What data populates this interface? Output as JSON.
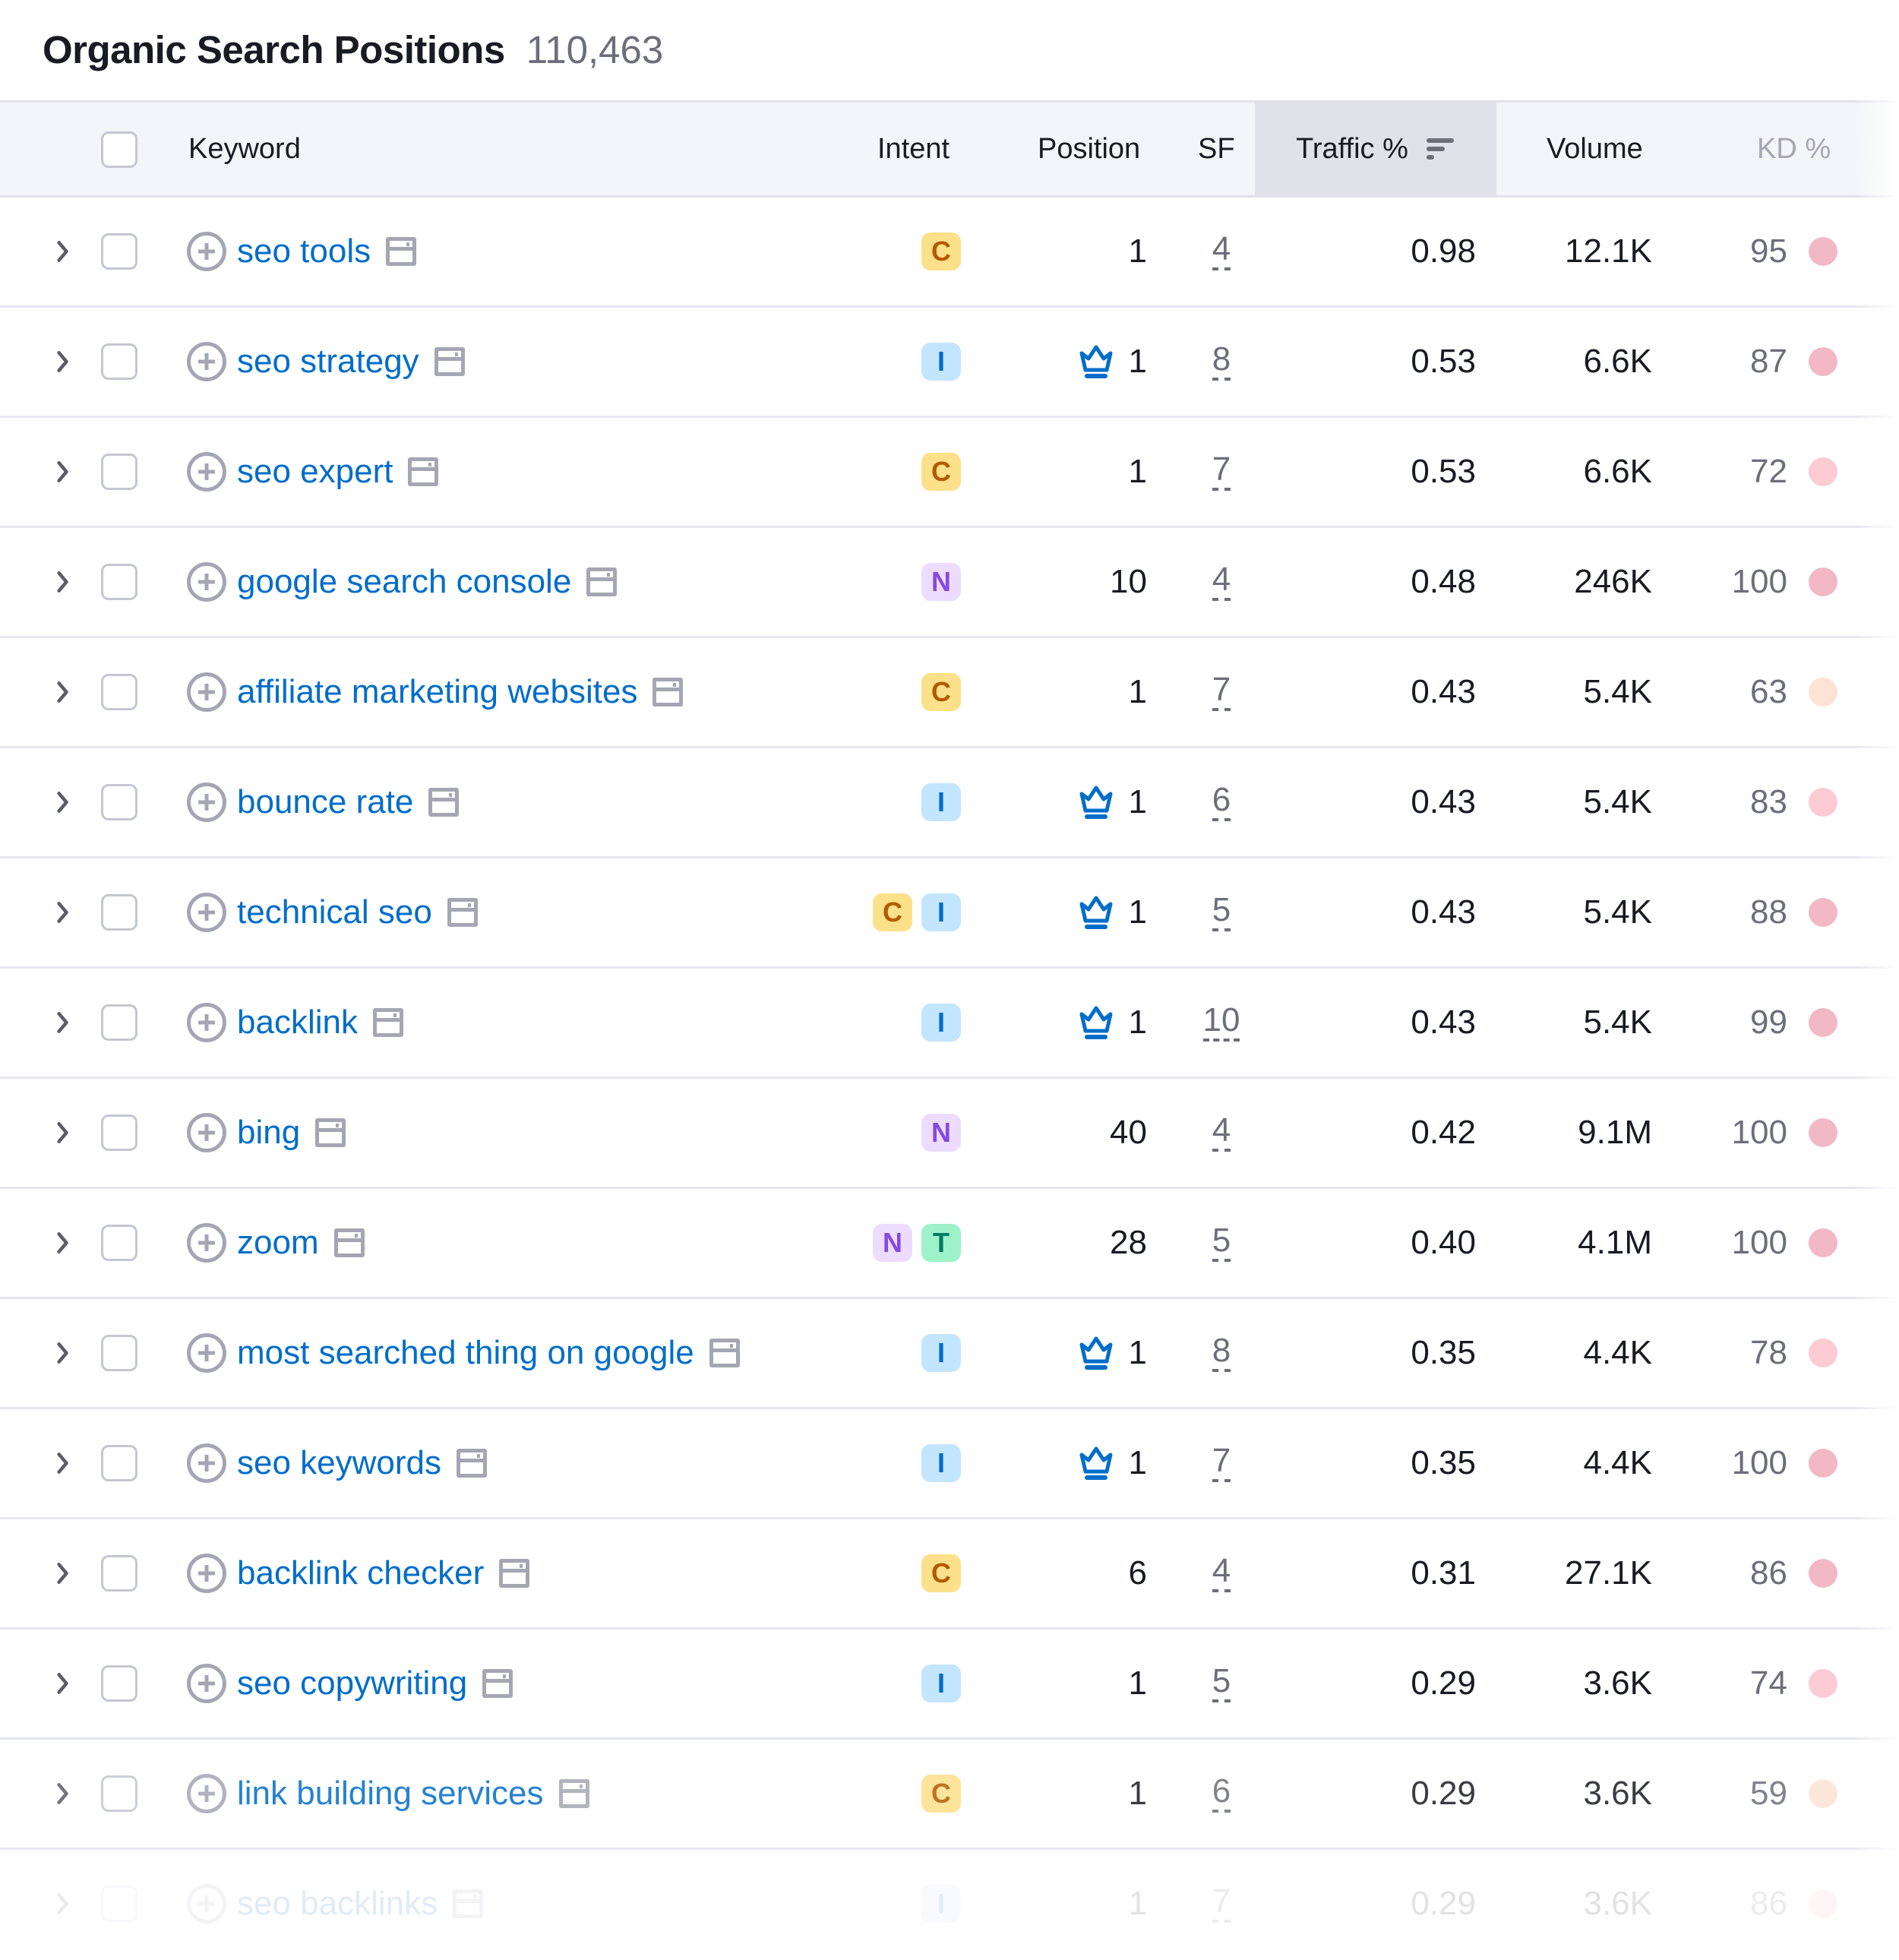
{
  "header": {
    "title": "Organic Search Positions",
    "count": "110,463"
  },
  "columns": {
    "keyword": "Keyword",
    "intent": "Intent",
    "position": "Position",
    "sf": "SF",
    "traffic": "Traffic %",
    "volume": "Volume",
    "kd": "KD %"
  },
  "intent_colors": {
    "C": {
      "bg": "#fde08a",
      "fg": "#b35a00"
    },
    "I": {
      "bg": "#c4e5fe",
      "fg": "#006dca"
    },
    "N": {
      "bg": "#eddcff",
      "fg": "#8649e1"
    },
    "T": {
      "bg": "#9ef2c9",
      "fg": "#007c65"
    }
  },
  "kd_colors": {
    "very_hard": "#f2b8c6",
    "hard": "#fccbd3",
    "difficult": "#fde3d5"
  },
  "rows": [
    {
      "keyword": "seo tools",
      "intent": [
        "C"
      ],
      "crown": false,
      "position": "1",
      "sf": "4",
      "traffic": "0.98",
      "volume": "12.1K",
      "kd": "95",
      "kd_level": "very_hard"
    },
    {
      "keyword": "seo strategy",
      "intent": [
        "I"
      ],
      "crown": true,
      "position": "1",
      "sf": "8",
      "traffic": "0.53",
      "volume": "6.6K",
      "kd": "87",
      "kd_level": "very_hard"
    },
    {
      "keyword": "seo expert",
      "intent": [
        "C"
      ],
      "crown": false,
      "position": "1",
      "sf": "7",
      "traffic": "0.53",
      "volume": "6.6K",
      "kd": "72",
      "kd_level": "hard"
    },
    {
      "keyword": "google search console",
      "intent": [
        "N"
      ],
      "crown": false,
      "position": "10",
      "sf": "4",
      "traffic": "0.48",
      "volume": "246K",
      "kd": "100",
      "kd_level": "very_hard"
    },
    {
      "keyword": "affiliate marketing websites",
      "intent": [
        "C"
      ],
      "crown": false,
      "position": "1",
      "sf": "7",
      "traffic": "0.43",
      "volume": "5.4K",
      "kd": "63",
      "kd_level": "difficult"
    },
    {
      "keyword": "bounce rate",
      "intent": [
        "I"
      ],
      "crown": true,
      "position": "1",
      "sf": "6",
      "traffic": "0.43",
      "volume": "5.4K",
      "kd": "83",
      "kd_level": "hard"
    },
    {
      "keyword": "technical seo",
      "intent": [
        "C",
        "I"
      ],
      "crown": true,
      "position": "1",
      "sf": "5",
      "traffic": "0.43",
      "volume": "5.4K",
      "kd": "88",
      "kd_level": "very_hard"
    },
    {
      "keyword": "backlink",
      "intent": [
        "I"
      ],
      "crown": true,
      "position": "1",
      "sf": "10",
      "traffic": "0.43",
      "volume": "5.4K",
      "kd": "99",
      "kd_level": "very_hard"
    },
    {
      "keyword": "bing",
      "intent": [
        "N"
      ],
      "crown": false,
      "position": "40",
      "sf": "4",
      "traffic": "0.42",
      "volume": "9.1M",
      "kd": "100",
      "kd_level": "very_hard"
    },
    {
      "keyword": "zoom",
      "intent": [
        "N",
        "T"
      ],
      "crown": false,
      "position": "28",
      "sf": "5",
      "traffic": "0.40",
      "volume": "4.1M",
      "kd": "100",
      "kd_level": "very_hard"
    },
    {
      "keyword": "most searched thing on google",
      "intent": [
        "I"
      ],
      "crown": true,
      "position": "1",
      "sf": "8",
      "traffic": "0.35",
      "volume": "4.4K",
      "kd": "78",
      "kd_level": "hard"
    },
    {
      "keyword": "seo keywords",
      "intent": [
        "I"
      ],
      "crown": true,
      "position": "1",
      "sf": "7",
      "traffic": "0.35",
      "volume": "4.4K",
      "kd": "100",
      "kd_level": "very_hard"
    },
    {
      "keyword": "backlink checker",
      "intent": [
        "C"
      ],
      "crown": false,
      "position": "6",
      "sf": "4",
      "traffic": "0.31",
      "volume": "27.1K",
      "kd": "86",
      "kd_level": "very_hard"
    },
    {
      "keyword": "seo copywriting",
      "intent": [
        "I"
      ],
      "crown": false,
      "position": "1",
      "sf": "5",
      "traffic": "0.29",
      "volume": "3.6K",
      "kd": "74",
      "kd_level": "hard"
    },
    {
      "keyword": "link building services",
      "intent": [
        "C"
      ],
      "crown": false,
      "position": "1",
      "sf": "6",
      "traffic": "0.29",
      "volume": "3.6K",
      "kd": "59",
      "kd_level": "difficult"
    },
    {
      "keyword": "seo backlinks",
      "intent": [
        "I"
      ],
      "crown": false,
      "position": "1",
      "sf": "7",
      "traffic": "0.29",
      "volume": "3.6K",
      "kd": "86",
      "kd_level": "very_hard"
    }
  ]
}
